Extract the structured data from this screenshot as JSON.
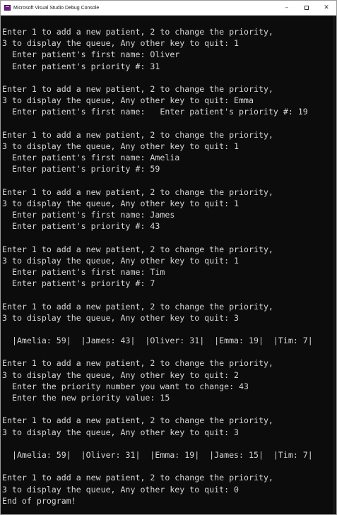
{
  "window": {
    "title": "Microsoft Visual Studio Debug Console",
    "minimize": "–",
    "close": "✕"
  },
  "console": {
    "lines": [
      "Enter 1 to add a new patient, 2 to change the priority,",
      "3 to display the queue, Any other key to quit: 1",
      "  Enter patient's first name: Oliver",
      "  Enter patient's priority #: 31",
      "",
      "Enter 1 to add a new patient, 2 to change the priority,",
      "3 to display the queue, Any other key to quit: Emma",
      "  Enter patient's first name:   Enter patient's priority #: 19",
      "",
      "Enter 1 to add a new patient, 2 to change the priority,",
      "3 to display the queue, Any other key to quit: 1",
      "  Enter patient's first name: Amelia",
      "  Enter patient's priority #: 59",
      "",
      "Enter 1 to add a new patient, 2 to change the priority,",
      "3 to display the queue, Any other key to quit: 1",
      "  Enter patient's first name: James",
      "  Enter patient's priority #: 43",
      "",
      "Enter 1 to add a new patient, 2 to change the priority,",
      "3 to display the queue, Any other key to quit: 1",
      "  Enter patient's first name: Tim",
      "  Enter patient's priority #: 7",
      "",
      "Enter 1 to add a new patient, 2 to change the priority,",
      "3 to display the queue, Any other key to quit: 3",
      "",
      "  |Amelia: 59|  |James: 43|  |Oliver: 31|  |Emma: 19|  |Tim: 7|",
      "",
      "Enter 1 to add a new patient, 2 to change the priority,",
      "3 to display the queue, Any other key to quit: 2",
      "  Enter the priority number you want to change: 43",
      "  Enter the new priority value: 15",
      "",
      "Enter 1 to add a new patient, 2 to change the priority,",
      "3 to display the queue, Any other key to quit: 3",
      "",
      "  |Amelia: 59|  |Oliver: 31|  |Emma: 19|  |James: 15|  |Tim: 7|",
      "",
      "Enter 1 to add a new patient, 2 to change the priority,",
      "3 to display the queue, Any other key to quit: 0",
      "End of program!"
    ]
  }
}
